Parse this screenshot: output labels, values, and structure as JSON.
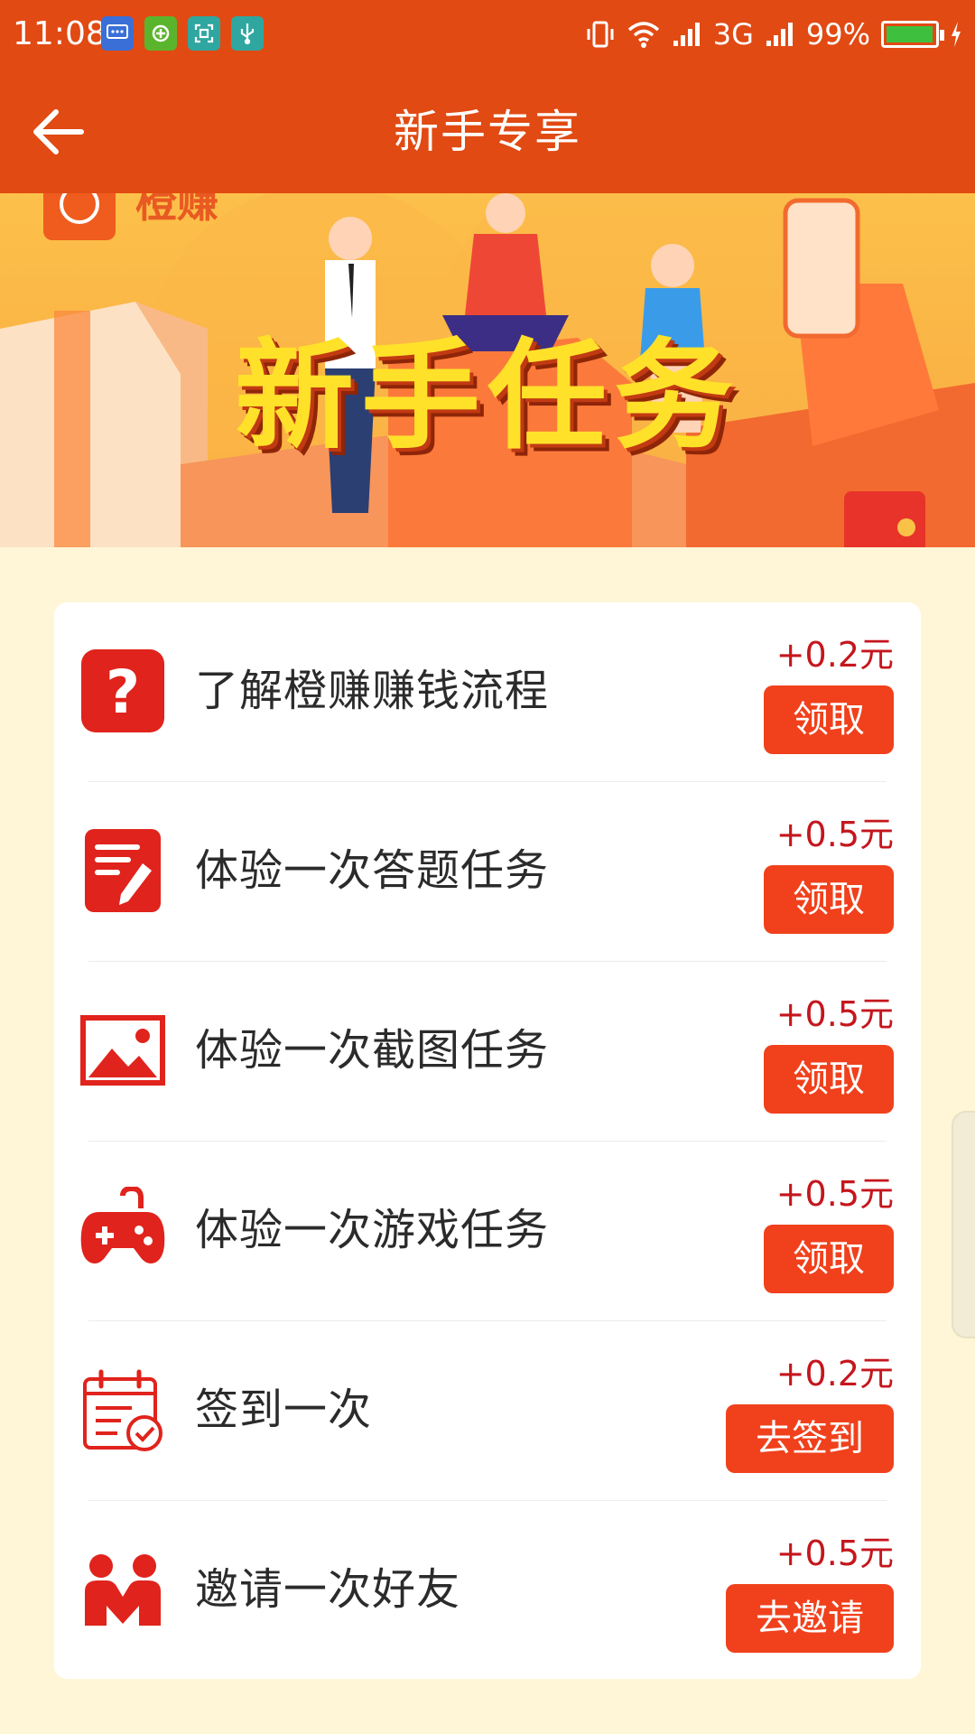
{
  "status_bar": {
    "time": "11:08",
    "network": "3G",
    "battery": "99%",
    "battery_level": 0.99
  },
  "header": {
    "title": "新手专享",
    "back_icon": "back-arrow-icon"
  },
  "banner": {
    "logo_text": "橙赚",
    "headline": "新手任务"
  },
  "tasks": [
    {
      "icon": "question-icon",
      "name": "了解橙赚赚钱流程",
      "reward": "+0.2元",
      "button": "领取"
    },
    {
      "icon": "edit-note-icon",
      "name": "体验一次答题任务",
      "reward": "+0.5元",
      "button": "领取"
    },
    {
      "icon": "image-icon",
      "name": "体验一次截图任务",
      "reward": "+0.5元",
      "button": "领取"
    },
    {
      "icon": "gamepad-icon",
      "name": "体验一次游戏任务",
      "reward": "+0.5元",
      "button": "领取"
    },
    {
      "icon": "calendar-check-icon",
      "name": "签到一次",
      "reward": "+0.2元",
      "button": "去签到"
    },
    {
      "icon": "invite-friends-icon",
      "name": "邀请一次好友",
      "reward": "+0.5元",
      "button": "去邀请"
    }
  ],
  "colors": {
    "primary": "#e14a13",
    "button": "#f0411c",
    "reward_text": "#c5161d",
    "page_bg": "#fef6d6"
  }
}
